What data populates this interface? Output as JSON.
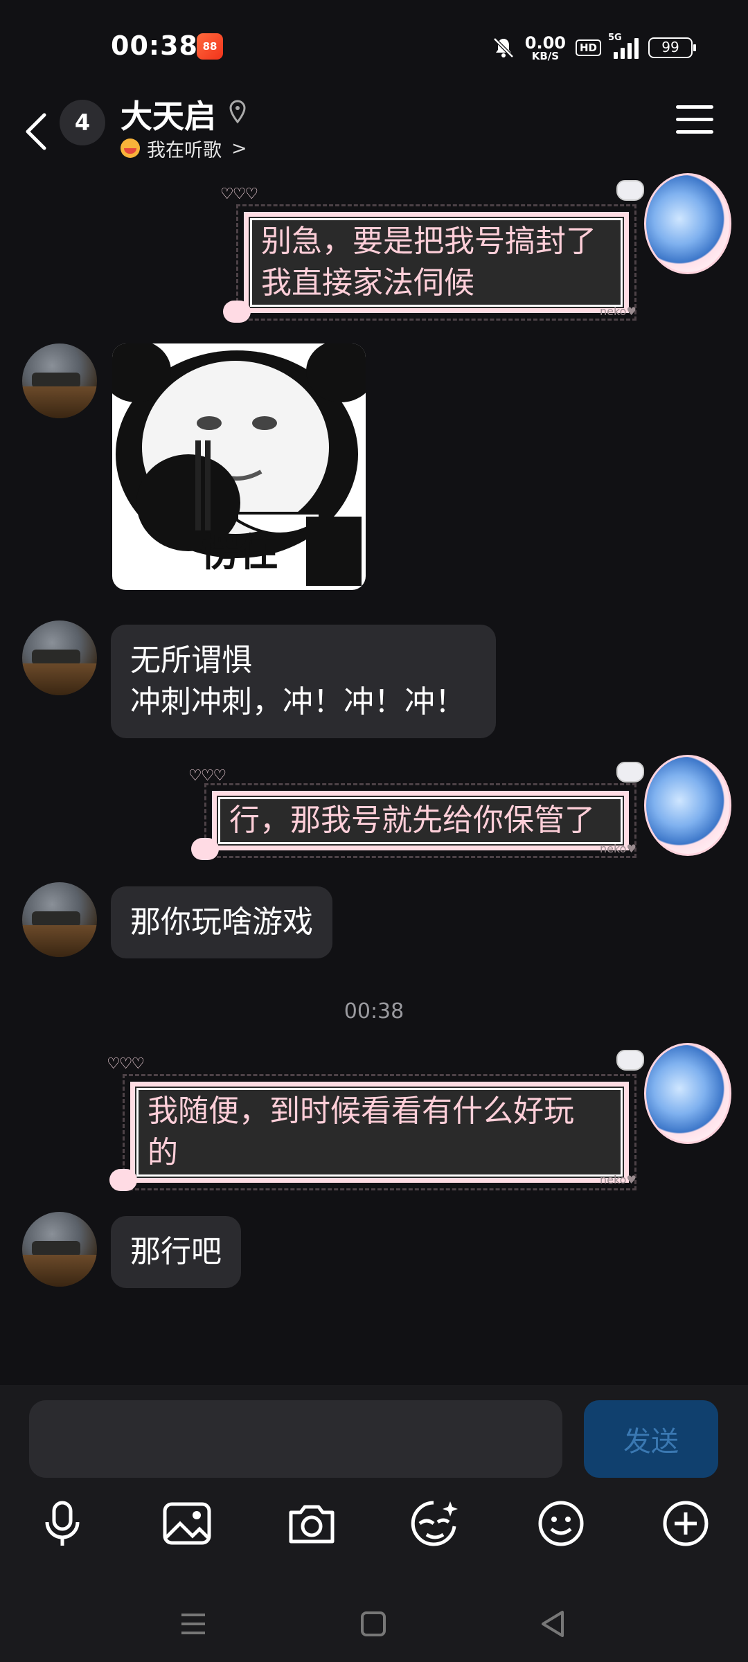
{
  "status_bar": {
    "time": "00:38",
    "app_badge": "88",
    "speed_value": "0.00",
    "speed_unit": "KB/S",
    "hd_label": "HD",
    "network": "5G",
    "battery": "99"
  },
  "header": {
    "unread_count": "4",
    "contact_name": "大天启",
    "status_text": "我在听歌",
    "status_chevron": ">"
  },
  "messages": [
    {
      "id": "m1",
      "side": "out",
      "lines": [
        "别急，要是把我号搞封了",
        "我直接家法伺候"
      ]
    },
    {
      "id": "m2",
      "side": "in",
      "type": "sticker",
      "caption": "愣住"
    },
    {
      "id": "m3",
      "side": "in",
      "lines": [
        "无所谓惧",
        "冲刺冲刺，冲！冲！冲！"
      ]
    },
    {
      "id": "m4",
      "side": "out",
      "lines": [
        "行，那我号就先给你保管了"
      ]
    },
    {
      "id": "m5",
      "side": "in",
      "lines": [
        "那你玩啥游戏"
      ]
    },
    {
      "id": "ts",
      "type": "timestamp",
      "text": "00:38"
    },
    {
      "id": "m6",
      "side": "out",
      "lines": [
        "我随便，到时候看看有什么好玩",
        "的"
      ]
    },
    {
      "id": "m7",
      "side": "in",
      "lines": [
        "那行吧"
      ]
    }
  ],
  "bubble_deco": {
    "neko": "neko♥",
    "hearts": "♡♡♡"
  },
  "input": {
    "value": "",
    "placeholder": "",
    "send_label": "发送"
  },
  "toolbar": [
    "mic-icon",
    "image-icon",
    "camera-icon",
    "sticker-icon",
    "emoji-icon",
    "plus-icon"
  ],
  "navbar": [
    "menu-icon",
    "home-icon",
    "back-icon"
  ],
  "colors": {
    "background": "#111114",
    "bubble_in": "#2b2b2f",
    "bubble_out_text": "#ffcfd9",
    "send_button": "#10406e"
  }
}
